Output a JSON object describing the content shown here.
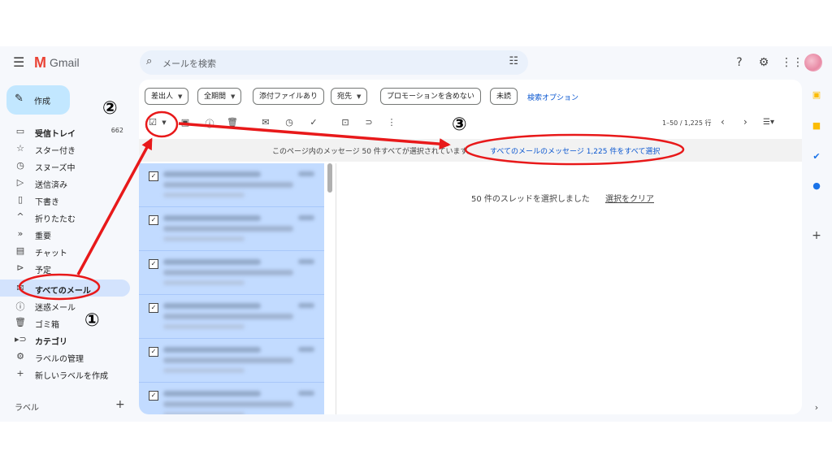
{
  "header": {
    "logo": "Gmail",
    "search_placeholder": "メールを検索"
  },
  "sidebar": {
    "compose": "作成",
    "items": [
      {
        "icon": "inbox-icon",
        "label": "受信トレイ",
        "count": "662",
        "bold": true
      },
      {
        "icon": "star-icon",
        "label": "スター付き"
      },
      {
        "icon": "clock-icon",
        "label": "スヌーズ中"
      },
      {
        "icon": "send-icon",
        "label": "送信済み"
      },
      {
        "icon": "draft-icon",
        "label": "下書き"
      },
      {
        "icon": "chevron-up-icon",
        "label": "折りたたむ"
      },
      {
        "icon": "important-icon",
        "label": "重要"
      },
      {
        "icon": "chat-icon",
        "label": "チャット"
      },
      {
        "icon": "scheduled-icon",
        "label": "予定"
      },
      {
        "icon": "all-mail-icon",
        "label": "すべてのメール",
        "bold": true,
        "active": true
      },
      {
        "icon": "spam-icon",
        "label": "迷惑メール"
      },
      {
        "icon": "trash-icon",
        "label": "ゴミ箱"
      },
      {
        "icon": "label-icon",
        "label": "カテゴリ",
        "bold": true
      },
      {
        "icon": "gear-icon",
        "label": "ラベルの管理"
      },
      {
        "icon": "plus-icon",
        "label": "新しいラベルを作成"
      }
    ],
    "labels_header": "ラベル"
  },
  "filters": {
    "chips": [
      "差出人",
      "全期間",
      "添付ファイルあり",
      "宛先",
      "プロモーションを含めない",
      "未読"
    ],
    "advanced": "検索オプション"
  },
  "toolbar": {
    "pager": "1–50 / 1,225 行"
  },
  "banner": {
    "text": "このページ内のメッセージ 50 件すべてが選択されています。",
    "link": "すべてのメールのメッセージ 1,225 件をすべて選択"
  },
  "preview": {
    "selected_text": "50 件のスレッドを選択しました",
    "clear": "選択をクリア"
  },
  "annotations": {
    "step1": "①",
    "step2": "②",
    "step3": "③",
    "color": "#e8191a"
  }
}
